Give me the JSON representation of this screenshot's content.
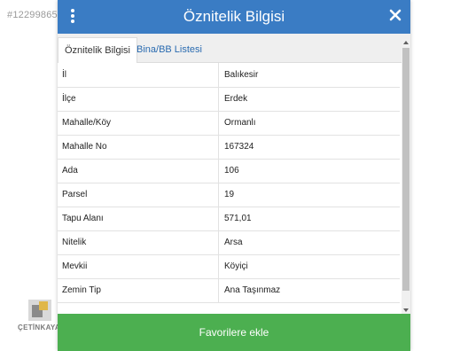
{
  "background": {
    "id_text": "#12299865"
  },
  "logo": {
    "brand": "ÇETİNKAYA"
  },
  "modal": {
    "title": "Öznitelik Bilgisi",
    "tabs": [
      {
        "label": "Öznitelik Bilgisi",
        "active": true
      },
      {
        "label": "Bina/BB Listesi",
        "active": false
      }
    ],
    "rows": [
      {
        "key": "İl",
        "value": "Balıkesir"
      },
      {
        "key": "İlçe",
        "value": "Erdek"
      },
      {
        "key": "Mahalle/Köy",
        "value": "Ormanlı"
      },
      {
        "key": "Mahalle No",
        "value": "167324"
      },
      {
        "key": "Ada",
        "value": "106"
      },
      {
        "key": "Parsel",
        "value": "19"
      },
      {
        "key": "Tapu Alanı",
        "value": "571,01"
      },
      {
        "key": "Nitelik",
        "value": "Arsa"
      },
      {
        "key": "Mevkii",
        "value": "Köyiçi"
      },
      {
        "key": "Zemin Tip",
        "value": "Ana Taşınmaz"
      }
    ],
    "favorite_button": "Favorilere ekle"
  },
  "colors": {
    "header": "#3a7cc4",
    "button": "#4caf50",
    "tab_link": "#2a6bb0"
  }
}
